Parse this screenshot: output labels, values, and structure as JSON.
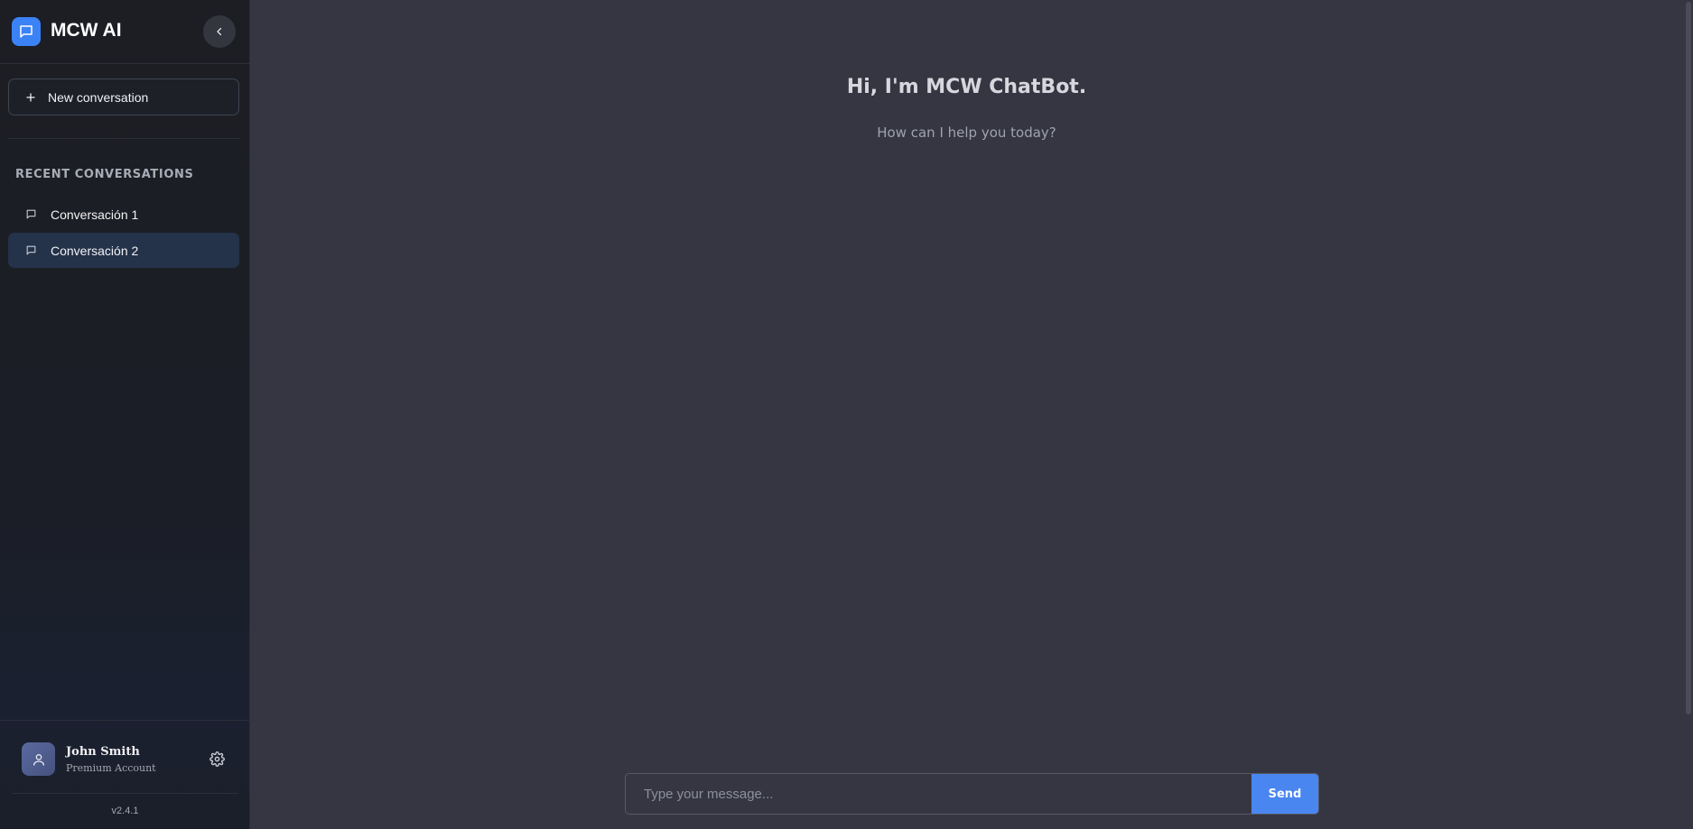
{
  "brand": {
    "name": "MCW AI",
    "logo_icon": "chat-bubble-icon",
    "accent": "#3b82f6"
  },
  "sidebar": {
    "collapse_icon": "chevron-left-icon",
    "new_conversation_label": "New conversation",
    "recent_heading": "RECENT CONVERSATIONS",
    "conversations": [
      {
        "label": "Conversación 1",
        "active": false,
        "icon": "chat-bubble-icon"
      },
      {
        "label": "Conversación 2",
        "active": true,
        "icon": "chat-bubble-icon"
      }
    ]
  },
  "user": {
    "name": "John Smith",
    "plan": "Premium Account",
    "avatar_icon": "user-icon",
    "settings_icon": "gear-icon"
  },
  "version": "v2.4.1",
  "main": {
    "greeting": "Hi, I'm MCW ChatBot.",
    "subgreeting": "How can I help you today?"
  },
  "composer": {
    "placeholder": "Type your message...",
    "value": "",
    "send_label": "Send",
    "send_color": "#4a86f0"
  }
}
